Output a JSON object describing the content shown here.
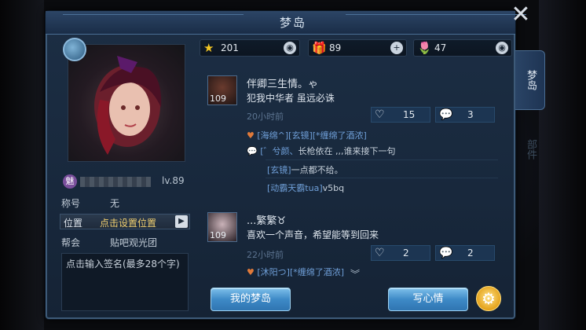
{
  "window": {
    "title": "梦岛",
    "close_symbol": "✕"
  },
  "profile": {
    "badge": "魅",
    "level": "lv.89",
    "rows": [
      {
        "label": "称号",
        "value": "无"
      },
      {
        "label": "帮会",
        "value": "贴吧观光团"
      }
    ],
    "position_label": "位置",
    "position_value": "点击设置位置",
    "signature_placeholder": "点击输入签名(最多28个字)"
  },
  "stats": [
    {
      "icon": "star-icon",
      "glyph": "★",
      "value": "201",
      "action": "eye-icon",
      "action_glyph": "◉"
    },
    {
      "icon": "gift-icon",
      "glyph": "🎁",
      "value": "89",
      "action": "plus-icon",
      "action_glyph": "+"
    },
    {
      "icon": "flower-icon",
      "glyph": "🌷",
      "value": "47",
      "action": "eye-icon",
      "action_glyph": "◉"
    }
  ],
  "tabs": {
    "active": "梦岛",
    "inactive": "部件"
  },
  "posts": [
    {
      "level": "109",
      "name": "伴卿三生情。ゃ",
      "text": "犯我中华者 虽远必诛",
      "time": "20小时前",
      "likes": "15",
      "comments": "3",
      "comment_lines": [
        {
          "user": "[海绵^][玄镜]",
          "text": "[*缠绵了酒浓]"
        },
        {
          "user": "[゛兮颜、",
          "text": "长枪依在 ,,,谁来接下一句"
        },
        {
          "user": "[玄镜]",
          "text": "一点都不给。"
        },
        {
          "user": "[动霸天霸tua]",
          "text": "v5bq"
        }
      ]
    },
    {
      "level": "109",
      "name": "...繁繁♉",
      "text": "喜欢一个声音，希望能等到回来",
      "time": "22小时前",
      "likes": "2",
      "comments": "2",
      "comment_lines": [
        {
          "user": "[沐阳つ]",
          "text": "[*缠绵了酒浓]"
        }
      ]
    }
  ],
  "buttons": {
    "my_island": "我的梦岛",
    "write_mood": "写心情",
    "settings_glyph": "⚙"
  },
  "colors": {
    "accent_gold": "#f1d070",
    "link_blue": "#6f9fd8",
    "panel_bg": "#1c2e44"
  }
}
